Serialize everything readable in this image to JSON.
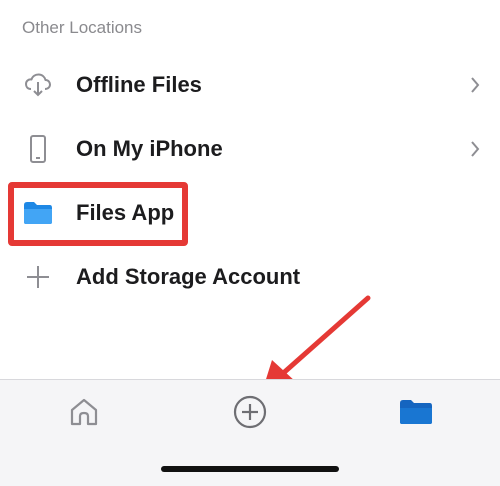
{
  "section": {
    "title": "Other Locations"
  },
  "rows": [
    {
      "label": "Offline Files",
      "icon": "cloud-download-icon",
      "has_chevron": true
    },
    {
      "label": "On My iPhone",
      "icon": "phone-icon",
      "has_chevron": true
    },
    {
      "label": "Files App",
      "icon": "folder-icon",
      "has_chevron": false,
      "highlighted": true
    },
    {
      "label": "Add Storage Account",
      "icon": "plus-icon",
      "has_chevron": false
    }
  ],
  "tabbar": {
    "tabs": [
      {
        "icon": "home-icon"
      },
      {
        "icon": "add-circle-icon"
      },
      {
        "icon": "folder-icon",
        "active": true
      }
    ]
  },
  "colors": {
    "accent": "#1565c0",
    "highlight": "#e53935",
    "icon_gray": "#8e8e93",
    "text": "#1c1c1e"
  }
}
